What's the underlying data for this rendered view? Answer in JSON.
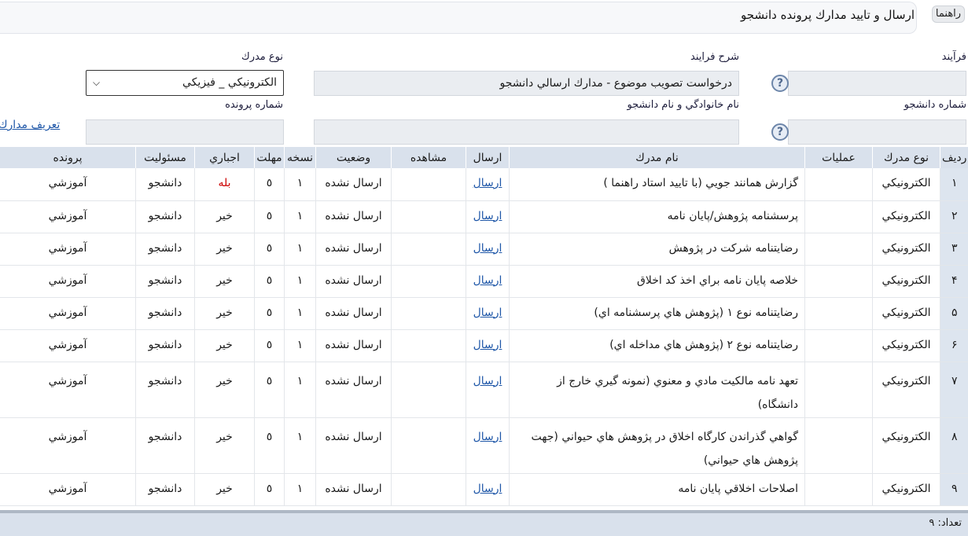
{
  "header": {
    "title": "ارسال و تاييد مدارك پرونده دانشجو",
    "help_label": "راهنما"
  },
  "form": {
    "process_label": "فرآيند",
    "process_value": "",
    "process_desc_label": "شرح فرايند",
    "process_desc_value": "درخواست تصويب موضوع - مدارك ارسالي دانشجو",
    "doc_type_label": "نوع مدرك",
    "doc_type_value": "الكترونيكي _ فيزيكي",
    "student_no_label": "شماره دانشجو",
    "student_no_value": "",
    "student_name_label": "نام خانوادگي و نام دانشجو",
    "student_name_value": "",
    "file_no_label": "شماره پرونده",
    "file_no_value": "",
    "define_docs_link": "تعريف مدارك"
  },
  "table": {
    "columns": [
      "رديف",
      "نوع مدرك",
      "عمليات",
      "نام مدرك",
      "ارسال",
      "مشاهده",
      "وضعيت",
      "نسخه",
      "مهلت",
      "اجباري",
      "مسئوليت",
      "پرونده"
    ],
    "rows": [
      {
        "no": "١",
        "type": "الكترونيكي",
        "name": "گزارش همانند جويي (با تاييد استاد راهنما )",
        "send": "ارسال",
        "status": "ارسال نشده",
        "copy": "١",
        "deadline": "٥",
        "mandatory": "بله",
        "resp": "دانشجو",
        "file": "آموزشي"
      },
      {
        "no": "٢",
        "type": "الكترونيكي",
        "name": "پرسشنامه پژوهش/پايان نامه",
        "send": "ارسال",
        "status": "ارسال نشده",
        "copy": "١",
        "deadline": "٥",
        "mandatory": "خير",
        "resp": "دانشجو",
        "file": "آموزشي"
      },
      {
        "no": "٣",
        "type": "الكترونيكي",
        "name": "رضايتنامه شركت در پژوهش",
        "send": "ارسال",
        "status": "ارسال نشده",
        "copy": "١",
        "deadline": "٥",
        "mandatory": "خير",
        "resp": "دانشجو",
        "file": "آموزشي"
      },
      {
        "no": "۴",
        "type": "الكترونيكي",
        "name": "خلاصه پايان نامه براي اخذ كد اخلاق",
        "send": "ارسال",
        "status": "ارسال نشده",
        "copy": "١",
        "deadline": "٥",
        "mandatory": "خير",
        "resp": "دانشجو",
        "file": "آموزشي"
      },
      {
        "no": "۵",
        "type": "الكترونيكي",
        "name": "رضايتنامه نوع ١ (پژوهش هاي پرسشنامه اي)",
        "send": "ارسال",
        "status": "ارسال نشده",
        "copy": "١",
        "deadline": "٥",
        "mandatory": "خير",
        "resp": "دانشجو",
        "file": "آموزشي"
      },
      {
        "no": "۶",
        "type": "الكترونيكي",
        "name": "رضايتنامه نوع ٢ (پژوهش هاي مداخله اي)",
        "send": "ارسال",
        "status": "ارسال نشده",
        "copy": "١",
        "deadline": "٥",
        "mandatory": "خير",
        "resp": "دانشجو",
        "file": "آموزشي"
      },
      {
        "no": "٧",
        "type": "الكترونيكي",
        "name": "تعهد نامه مالكيت مادي و معنوي (نمونه گيري خارج از دانشگاه)",
        "send": "ارسال",
        "status": "ارسال نشده",
        "copy": "١",
        "deadline": "٥",
        "mandatory": "خير",
        "resp": "دانشجو",
        "file": "آموزشي"
      },
      {
        "no": "٨",
        "type": "الكترونيكي",
        "name": "گواهي گذراندن كارگاه اخلاق در پژوهش هاي حيواني (جهت پژوهش هاي حيواني)",
        "send": "ارسال",
        "status": "ارسال نشده",
        "copy": "١",
        "deadline": "٥",
        "mandatory": "خير",
        "resp": "دانشجو",
        "file": "آموزشي"
      },
      {
        "no": "٩",
        "type": "الكترونيكي",
        "name": "اصلاحات اخلاقي پايان نامه",
        "send": "ارسال",
        "status": "ارسال نشده",
        "copy": "١",
        "deadline": "٥",
        "mandatory": "خير",
        "resp": "دانشجو",
        "file": "آموزشي"
      }
    ]
  },
  "footer": {
    "count_text": "تعداد: ٩"
  }
}
